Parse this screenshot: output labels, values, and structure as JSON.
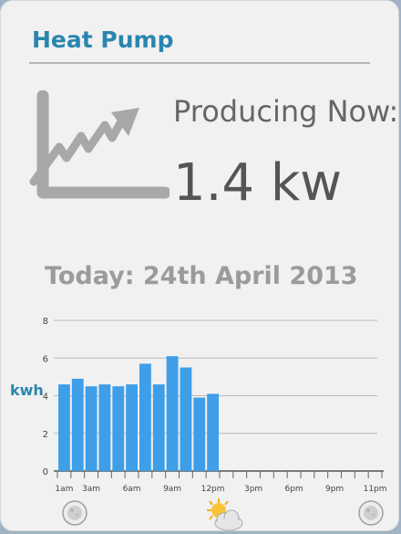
{
  "header": {
    "title": "Heat Pump"
  },
  "production": {
    "label": "Producing Now:",
    "value": "1.4 kw"
  },
  "today": {
    "heading": "Today: 24th April 2013"
  },
  "chart_data": {
    "type": "bar",
    "ylabel": "kwh",
    "ylim": [
      0,
      8
    ],
    "yticks": [
      0,
      2,
      4,
      6,
      8
    ],
    "slots": 24,
    "values": [
      4.6,
      4.9,
      4.5,
      4.6,
      4.5,
      4.6,
      5.7,
      4.6,
      6.1,
      5.5,
      3.9,
      4.1
    ],
    "xtick_labels": [
      {
        "slot": 0,
        "label": "1am"
      },
      {
        "slot": 2,
        "label": "3am"
      },
      {
        "slot": 5,
        "label": "6am"
      },
      {
        "slot": 8,
        "label": "9am"
      },
      {
        "slot": 11,
        "label": "12pm"
      },
      {
        "slot": 14,
        "label": "3pm"
      },
      {
        "slot": 17,
        "label": "6pm"
      },
      {
        "slot": 20,
        "label": "9pm"
      },
      {
        "slot": 23,
        "label": "11pm"
      }
    ],
    "grid": true,
    "bar_color": "#3e9ee8"
  },
  "colors": {
    "accent": "#2a86b0",
    "bar": "#3e9ee8",
    "icon_gray": "#a8a8a8"
  },
  "footer": {
    "left_icon": "moon-icon",
    "center_icon": "sun-cloud-icon",
    "right_icon": "moon-icon"
  }
}
